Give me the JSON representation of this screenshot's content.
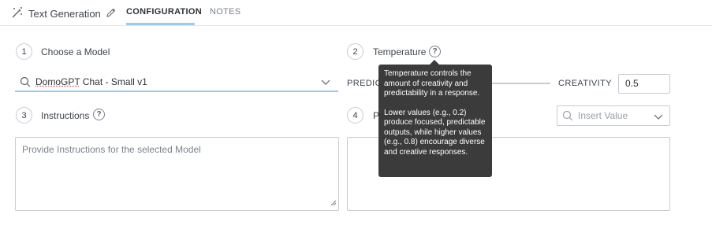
{
  "header": {
    "title": "Text Generation",
    "icons": {
      "app": "magic-wand-icon",
      "edit": "pencil-icon"
    },
    "tabs": [
      {
        "label": "CONFIGURATION",
        "active": true
      },
      {
        "label": "NOTES",
        "active": false
      }
    ]
  },
  "steps": {
    "model": {
      "number": "1",
      "label": "Choose a Model"
    },
    "temperature": {
      "number": "2",
      "label": "Temperature"
    },
    "instructions": {
      "number": "3",
      "label": "Instructions"
    },
    "prompt": {
      "number": "4",
      "label": "P"
    }
  },
  "model_select": {
    "value_prefix": "DomoGPT",
    "value_rest": " Chat - Small v1",
    "search_icon": "search-icon",
    "chevron_icon": "chevron-down-icon"
  },
  "temperature": {
    "left_label": "PREDICT",
    "right_label": "CREATIVITY",
    "value": "0.5"
  },
  "insert_value": {
    "placeholder": "Insert Value"
  },
  "instructions": {
    "placeholder": "Provide Instructions for the selected Model"
  },
  "tooltip": {
    "line1": "Temperature controls the amount of creativity and predictability in a response.",
    "line2": "Lower values (e.g., 0.2) produce focused, predictable outputs, while higher values (e.g., 0.8) encourage diverse and creative responses."
  },
  "colors": {
    "accent": "#99ccee",
    "tooltip_bg": "#3b3b3b",
    "border": "#c7ccd2"
  }
}
